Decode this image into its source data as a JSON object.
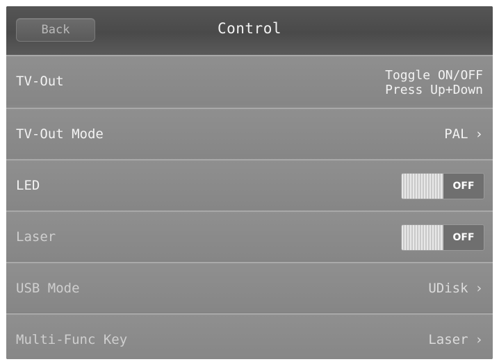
{
  "header": {
    "back_label": "Back",
    "title": "Control"
  },
  "rows": [
    {
      "label": "TV-Out",
      "hint_line1": "Toggle ON/OFF",
      "hint_line2": "Press Up+Down"
    },
    {
      "label": "TV-Out Mode",
      "value": "PAL",
      "chevron": "›"
    },
    {
      "label": "LED",
      "toggle_state": "OFF"
    },
    {
      "label": "Laser",
      "toggle_state": "OFF"
    },
    {
      "label": "USB Mode",
      "value": "UDisk",
      "chevron": "›"
    },
    {
      "label": "Multi-Func Key",
      "value": "Laser",
      "chevron": "›"
    }
  ],
  "icons": {
    "chevron": "chevron-right-icon"
  },
  "colors": {
    "titlebar": "#4f4f4f",
    "row_background": "#8a8a8a",
    "separator": "#a9a9a9",
    "text": "#f3f3f3"
  }
}
